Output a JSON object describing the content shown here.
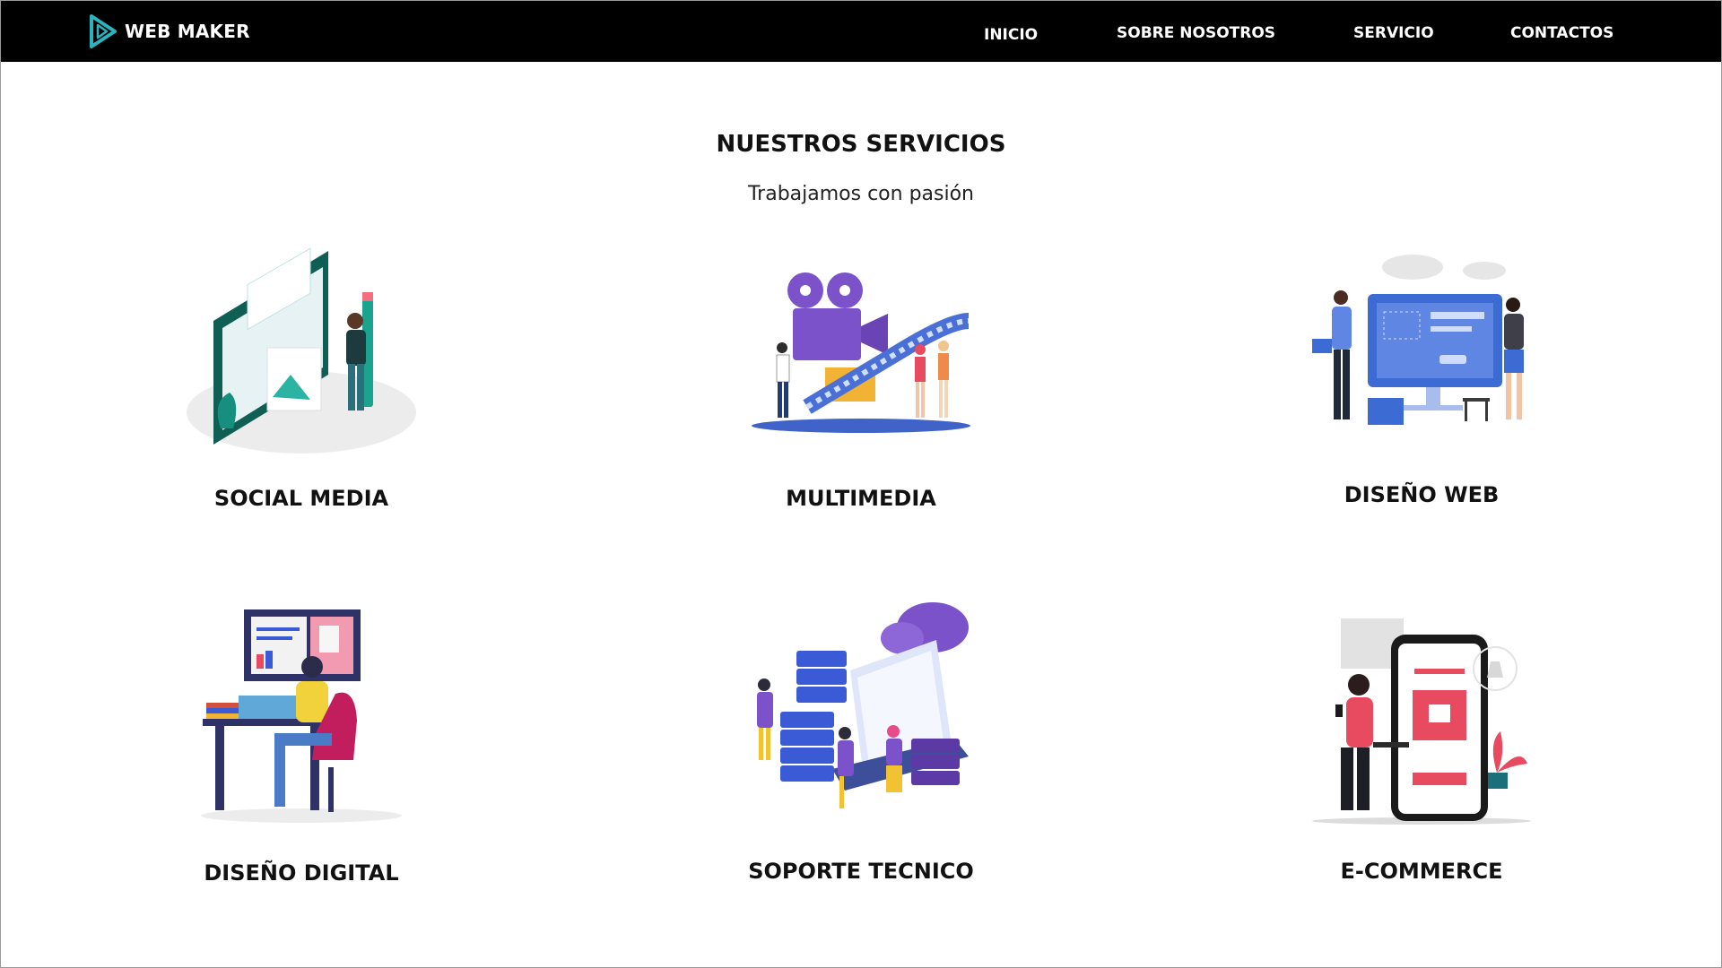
{
  "header": {
    "logo_text": "WEB MAKER",
    "logo_icon": "play-logo-icon",
    "nav": [
      "INICIO",
      "SOBRE NOSOTROS",
      "SERVICIO",
      "CONTACTOS"
    ]
  },
  "section": {
    "title": "NUESTROS SERVICIOS",
    "subtitle": "Trabajamos con pasión"
  },
  "services": [
    {
      "label": "SOCIAL MEDIA",
      "icon": "social-media-illustration"
    },
    {
      "label": "MULTIMEDIA",
      "icon": "multimedia-illustration"
    },
    {
      "label": "DISEÑO WEB",
      "icon": "web-design-illustration"
    },
    {
      "label": "DISEÑO DIGITAL",
      "icon": "digital-design-illustration"
    },
    {
      "label": "SOPORTE TECNICO",
      "icon": "tech-support-illustration"
    },
    {
      "label": "E-COMMERCE",
      "icon": "ecommerce-illustration"
    }
  ],
  "colors": {
    "navbar": "#000000",
    "logo_accent": "#2bb3c0",
    "teal": "#0f6e63",
    "purple": "#7b52c9",
    "blue": "#4a6fd6",
    "red": "#e84a5f"
  }
}
